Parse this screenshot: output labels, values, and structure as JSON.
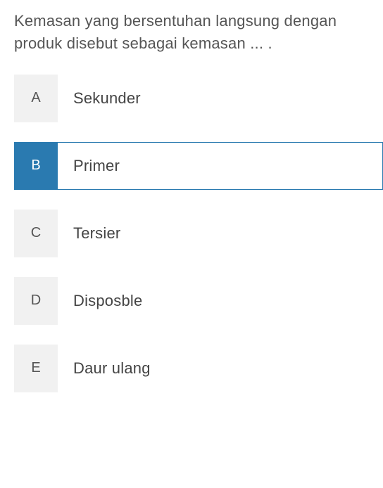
{
  "question": {
    "text": "Kemasan yang bersentuhan langsung dengan produk disebut sebagai kemasan ... ."
  },
  "options": [
    {
      "letter": "A",
      "label": "Sekunder",
      "selected": false
    },
    {
      "letter": "B",
      "label": "Primer",
      "selected": true
    },
    {
      "letter": "C",
      "label": "Tersier",
      "selected": false
    },
    {
      "letter": "D",
      "label": "Disposble",
      "selected": false
    },
    {
      "letter": "E",
      "label": "Daur ulang",
      "selected": false
    }
  ]
}
